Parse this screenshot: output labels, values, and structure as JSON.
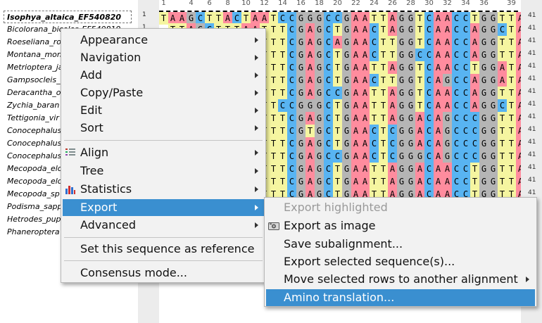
{
  "sequences": [
    {
      "name": "Isophya_altaica_EF540820",
      "selected": true
    },
    {
      "name": "Bicolorana_bicolor_EF540819"
    },
    {
      "name": "Roeseliana_ro"
    },
    {
      "name": "Montana_mon"
    },
    {
      "name": "Metrioptera_ja"
    },
    {
      "name": "Gampsocleis_"
    },
    {
      "name": "Deracantha_o"
    },
    {
      "name": "Zychia_baran"
    },
    {
      "name": "Tettigonia_vir"
    },
    {
      "name": "Conocephalus"
    },
    {
      "name": "Conocephalus"
    },
    {
      "name": "Conocephalus"
    },
    {
      "name": "Mecopoda_elo"
    },
    {
      "name": "Mecopoda_elo"
    },
    {
      "name": "Mecopoda_sp"
    },
    {
      "name": "Podisma_sapp"
    },
    {
      "name": "Hetrodes_pup"
    },
    {
      "name": "Phaneroptera"
    }
  ],
  "row_start_numbers": [
    "1",
    "1"
  ],
  "row_length_label": "41",
  "ruler_ticks": [
    "1",
    "4",
    "6",
    "8",
    "10",
    "12",
    "14",
    "16",
    "18",
    "20",
    "22",
    "24",
    "26",
    "28",
    "30",
    "32",
    "34",
    "36",
    "39"
  ],
  "alignment": [
    "TAAGCTTACTAATCCGGGCCGAATTAGGTCAACCTGGTTA",
    "TTAGCTTTAATTTCGAGCTGAACTAGGTCAACCAGGCTA",
    "GGCTAACTTTTCGAGCAGAACTTGGTCAACCAGGTTA",
    "GGCTAAACTTTCGAGCTGAACTTGGCCAACCAGGTTA",
    "GGCTAAACTTTCGAGCTGAATTAGGTCAACCTGGATA",
    "GGCTAAACTTTCGAGCTGAACTTGGTCAGCCAGGATA",
    "GGCTAAACTTTCGAGCCGAATTAGGTCAACCAGGTTA",
    "GGCTAAACTTCCGGGCTGAATTAGGTCAACCAGGCTA",
    "GGCTAAACTTTCGAGCTGAATTAGGACAGCCCGGTTA",
    "GGCTAAACTTTCGTGCTGAACTCGGACAGCCCGGTTA",
    "GGCTAAACTTTCGAGCTGAACTCGGACAGCCCGGTTA",
    "GGCTAAACTTTCGAGCCGAACTCGGGCAGCCCGGTTA",
    "GGCTAAACTTTCGAGCTGAATTAGGACAACCTGGTTA",
    "GGCTAAACTTTCGAGCTGAATTAGGACAACCTGGTTA",
    "GGCTAAACTTTCGAGCTGAATTAGGACAACCTGGTTA",
    "GGCTAAACTTTCGAGCTGAATTAGGACAACCTGGTTA",
    "GGCTAAACTTTCGAGCTGAATTAGGACAACCTGGTTA",
    "GGCTAAACTTTCGAGCTGAATTAGGACAACCTGGTTA"
  ],
  "base_colors": {
    "A": "#ff8c9e",
    "C": "#58b4f2",
    "G": "#b5b5b5",
    "T": "#f5f5a0",
    "-": "#ffffff"
  },
  "context_menu": {
    "items": [
      {
        "label": "Appearance",
        "submenu": true
      },
      {
        "label": "Navigation",
        "submenu": true
      },
      {
        "label": "Add",
        "submenu": true
      },
      {
        "label": "Copy/Paste",
        "submenu": true
      },
      {
        "label": "Edit",
        "submenu": true
      },
      {
        "label": "Sort",
        "submenu": true
      },
      {
        "label": "Align",
        "submenu": true,
        "icon": "align-icon"
      },
      {
        "label": "Tree",
        "submenu": true
      },
      {
        "label": "Statistics",
        "submenu": true,
        "icon": "statistics-icon"
      },
      {
        "label": "Export",
        "submenu": true,
        "highlighted": true
      },
      {
        "label": "Advanced",
        "submenu": true
      },
      {
        "label": "Set this sequence as reference"
      },
      {
        "label": "Consensus mode..."
      }
    ]
  },
  "export_submenu": {
    "items": [
      {
        "label": "Export highlighted",
        "disabled": true
      },
      {
        "label": "Export as image",
        "icon": "image-icon"
      },
      {
        "label": "Save subalignment..."
      },
      {
        "label": "Export selected sequence(s)..."
      },
      {
        "label": "Move selected rows to another alignment",
        "submenu": true
      },
      {
        "label": "Amino translation...",
        "highlighted": true
      }
    ]
  }
}
